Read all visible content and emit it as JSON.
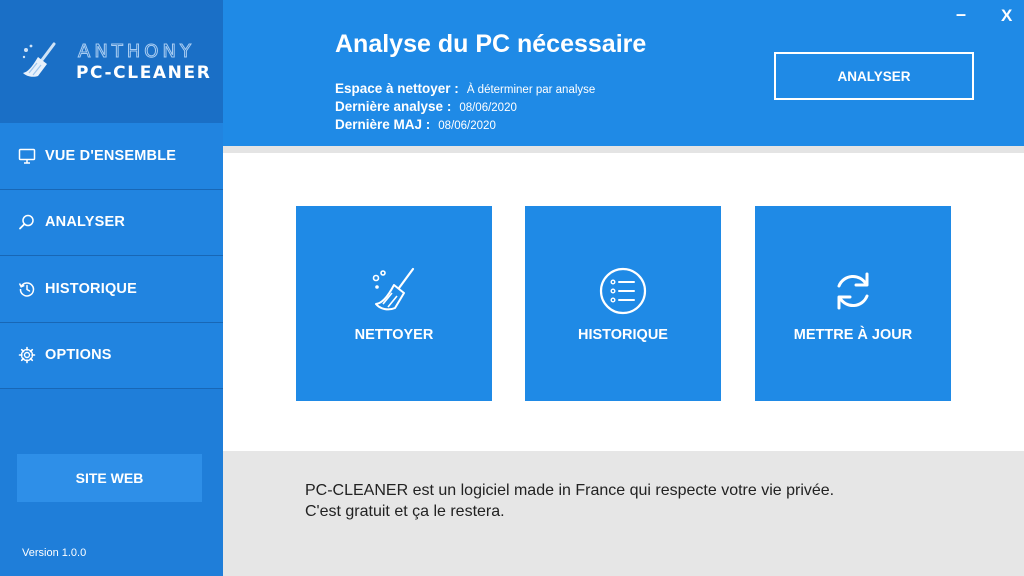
{
  "brand": {
    "line1": "ANTHONY",
    "line2": "PC-CLEANER"
  },
  "sidebar": {
    "items": [
      {
        "label": "VUE D'ENSEMBLE",
        "icon": "monitor-icon"
      },
      {
        "label": "ANALYSER",
        "icon": "search-icon"
      },
      {
        "label": "HISTORIQUE",
        "icon": "history-icon"
      },
      {
        "label": "OPTIONS",
        "icon": "gear-icon"
      }
    ],
    "site_button": "SITE WEB",
    "version": "Version 1.0.0"
  },
  "header": {
    "title": "Analyse du PC nécessaire",
    "space_label": "Espace à nettoyer :",
    "space_value": "À déterminer par analyse",
    "last_scan_label": "Dernière analyse :",
    "last_scan_value": "08/06/2020",
    "last_update_label": "Dernière MAJ :",
    "last_update_value": "08/06/2020",
    "analyse_button": "ANALYSER",
    "minimize": "–",
    "close": "X"
  },
  "tiles": [
    {
      "label": "NETTOYER",
      "icon": "broom-icon"
    },
    {
      "label": "HISTORIQUE",
      "icon": "list-icon"
    },
    {
      "label": "METTRE À JOUR",
      "icon": "refresh-icon"
    }
  ],
  "footer": {
    "line1": "PC-CLEANER est un logiciel made in France qui respecte votre vie privée.",
    "line2": "C'est gratuit et ça le restera."
  },
  "colors": {
    "sidebar": "#1f7ed9",
    "header": "#1f8ae6",
    "tile": "#1f8ae6",
    "footer": "#e6e6e6"
  }
}
